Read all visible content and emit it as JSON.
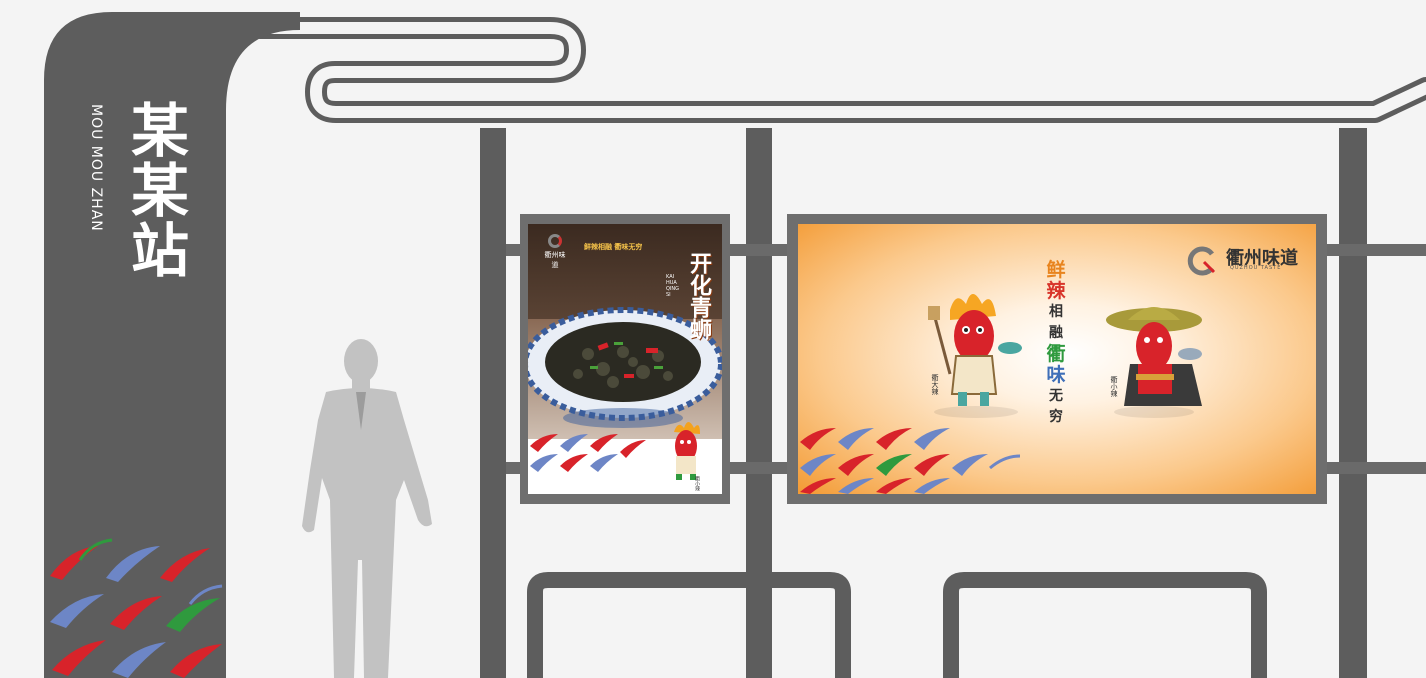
{
  "station": {
    "name_cn": "某某站",
    "name_en": "MOU MOU ZHAN"
  },
  "poster_left": {
    "logo_text": "衢州味道",
    "slogan": "鲜辣相融 衢味无穷",
    "title": "开化青蛳",
    "pinyin": "KAI HUA QING SI",
    "character_label": "衢小辣"
  },
  "billboard": {
    "logo_text": "衢州味道",
    "logo_sub": "QUZHOU TASTE",
    "slogan_chars": [
      {
        "char": "鲜",
        "color": "#e8841e",
        "size": 19
      },
      {
        "char": "辣",
        "color": "#d8342a",
        "size": 19
      },
      {
        "char": "相",
        "color": "#333333",
        "size": 14
      },
      {
        "char": "融",
        "color": "#333333",
        "size": 14
      },
      {
        "char": "衢",
        "color": "#2f9a3e",
        "size": 19
      },
      {
        "char": "味",
        "color": "#3f6fb8",
        "size": 19
      },
      {
        "char": "无",
        "color": "#333333",
        "size": 14
      },
      {
        "char": "穷",
        "color": "#333333",
        "size": 14
      }
    ],
    "character_left_name": "衢大辣",
    "character_right_name": "衢小辣"
  },
  "colors": {
    "structure": "#5d5d5d",
    "structure_dark": "#4a4a4a",
    "pillar_light": "#6a6a6a",
    "background": "#f4f4f4",
    "silhouette": "#c2c2c2",
    "chili_red": "#d8232a",
    "chili_blue": "#6d86c6",
    "chili_green": "#2f9a3e"
  }
}
